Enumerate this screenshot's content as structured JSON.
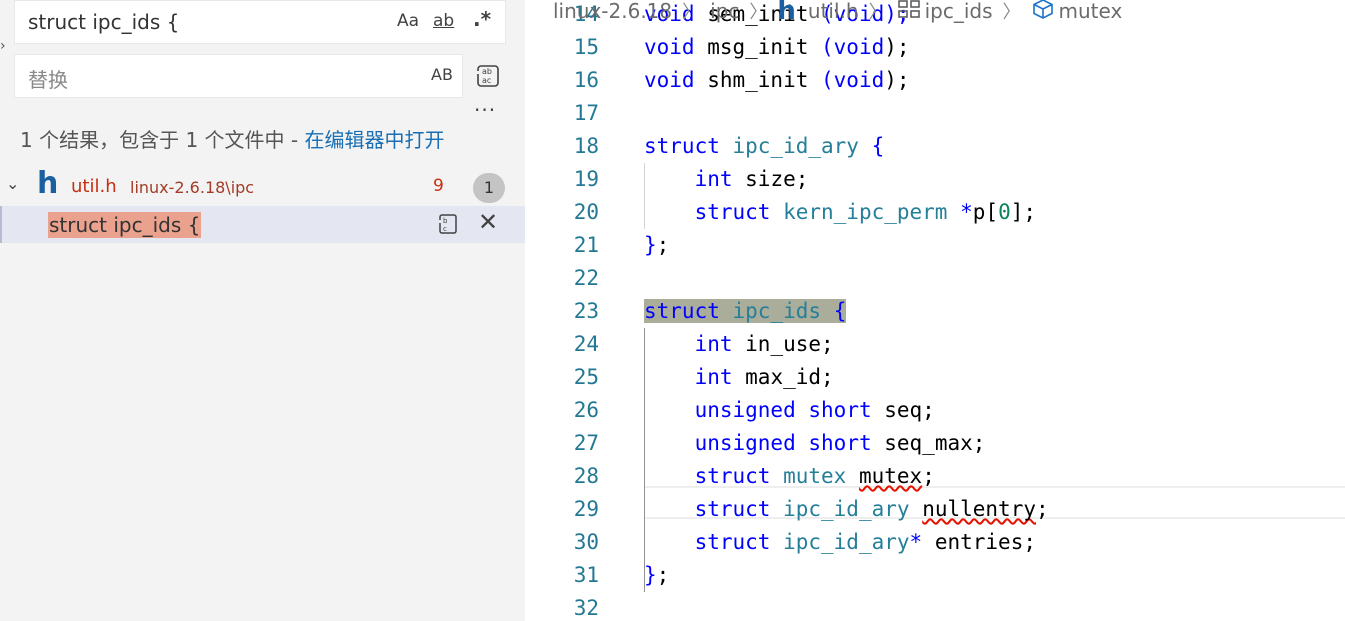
{
  "search": {
    "query": "struct ipc_ids {",
    "match_case_label": "Aa",
    "whole_word_label": "ab",
    "regex_label": ".*",
    "replace_placeholder": "替换",
    "preserve_case_label": "AB",
    "more_options": "···"
  },
  "results": {
    "summary_prefix": "1 个结果，包含于 1 个文件中 - ",
    "summary_link": "在编辑器中打开",
    "file": {
      "icon_letter": "h",
      "name": "util.h",
      "path": "linux-2.6.18\\ipc",
      "problems": "9",
      "match_count": "1"
    },
    "match": {
      "text": "struct ipc_ids {"
    }
  },
  "breadcrumb": {
    "folder": "linux-2.6.18",
    "subfolder": "ipc",
    "file_icon": "h",
    "file": "util.h",
    "struct": "ipc_ids",
    "field": "mutex"
  },
  "editor": {
    "lines": [
      {
        "n": "14",
        "tokens": [
          [
            "kw",
            "void"
          ],
          [
            "t",
            " sem_init "
          ],
          [
            "kw",
            "(void);"
          ]
        ]
      },
      {
        "n": "15",
        "tokens": [
          [
            "kw",
            "void"
          ],
          [
            "t",
            " msg_init "
          ],
          [
            "kw",
            "(void"
          ],
          [
            "t",
            ");"
          ]
        ]
      },
      {
        "n": "16",
        "tokens": [
          [
            "kw",
            "void"
          ],
          [
            "t",
            " shm_init "
          ],
          [
            "kw",
            "(void"
          ],
          [
            "t",
            ");"
          ]
        ]
      },
      {
        "n": "17",
        "tokens": []
      },
      {
        "n": "18",
        "tokens": [
          [
            "kw",
            "struct"
          ],
          [
            "t",
            " "
          ],
          [
            "ty",
            "ipc_id_ary"
          ],
          [
            "t",
            " "
          ],
          [
            "kw",
            "{"
          ]
        ]
      },
      {
        "n": "19",
        "tokens": [
          [
            "t",
            "    "
          ],
          [
            "kw",
            "int"
          ],
          [
            "t",
            " size;"
          ]
        ]
      },
      {
        "n": "20",
        "tokens": [
          [
            "t",
            "    "
          ],
          [
            "kw",
            "struct"
          ],
          [
            "t",
            " "
          ],
          [
            "ty",
            "kern_ipc_perm"
          ],
          [
            "t",
            " "
          ],
          [
            "kw",
            "*"
          ],
          [
            "t",
            "p["
          ],
          [
            "num",
            "0"
          ],
          [
            "t",
            "];"
          ]
        ]
      },
      {
        "n": "21",
        "tokens": [
          [
            "kw",
            "}"
          ],
          [
            "t",
            ";"
          ]
        ]
      },
      {
        "n": "22",
        "tokens": []
      },
      {
        "n": "23",
        "tokens": [
          [
            "hlkw",
            "struct"
          ],
          [
            "hlt",
            " "
          ],
          [
            "hlty",
            "ipc_ids"
          ],
          [
            "hlt",
            " "
          ],
          [
            "hlkw",
            "{"
          ]
        ]
      },
      {
        "n": "24",
        "tokens": [
          [
            "t",
            "    "
          ],
          [
            "kw",
            "int"
          ],
          [
            "t",
            " in_use;"
          ]
        ]
      },
      {
        "n": "25",
        "tokens": [
          [
            "t",
            "    "
          ],
          [
            "kw",
            "int"
          ],
          [
            "t",
            " max_id;"
          ]
        ]
      },
      {
        "n": "26",
        "tokens": [
          [
            "t",
            "    "
          ],
          [
            "kw",
            "unsigned"
          ],
          [
            "t",
            " "
          ],
          [
            "kw",
            "short"
          ],
          [
            "t",
            " seq;"
          ]
        ]
      },
      {
        "n": "27",
        "tokens": [
          [
            "t",
            "    "
          ],
          [
            "kw",
            "unsigned"
          ],
          [
            "t",
            " "
          ],
          [
            "kw",
            "short"
          ],
          [
            "t",
            " seq_max;"
          ]
        ]
      },
      {
        "n": "28",
        "tokens": [
          [
            "t",
            "    "
          ],
          [
            "kw",
            "struct"
          ],
          [
            "t",
            " "
          ],
          [
            "ty",
            "mutex"
          ],
          [
            "t",
            " "
          ],
          [
            "sq",
            "mutex"
          ],
          [
            "t",
            ";"
          ]
        ]
      },
      {
        "n": "29",
        "tokens": [
          [
            "t",
            "    "
          ],
          [
            "kw",
            "struct"
          ],
          [
            "t",
            " "
          ],
          [
            "ty",
            "ipc_id_ary"
          ],
          [
            "t",
            " "
          ],
          [
            "sq",
            "nullentry"
          ],
          [
            "t",
            ";"
          ]
        ]
      },
      {
        "n": "30",
        "tokens": [
          [
            "t",
            "    "
          ],
          [
            "kw",
            "struct"
          ],
          [
            "t",
            " "
          ],
          [
            "ty",
            "ipc_id_ary"
          ],
          [
            "kw",
            "*"
          ],
          [
            "t",
            " entries;"
          ]
        ]
      },
      {
        "n": "31",
        "tokens": [
          [
            "kw",
            "}"
          ],
          [
            "t",
            ";"
          ]
        ]
      },
      {
        "n": "32",
        "tokens": []
      }
    ]
  },
  "colors": {
    "keyword": "#0000ff",
    "type": "#267f99",
    "number": "#098658",
    "line_number": "#237893",
    "match_highlight": "#eaa28e",
    "find_highlight": "#a9ad9a",
    "error_squiggle": "#e51400",
    "file_name": "#c72e0f"
  }
}
